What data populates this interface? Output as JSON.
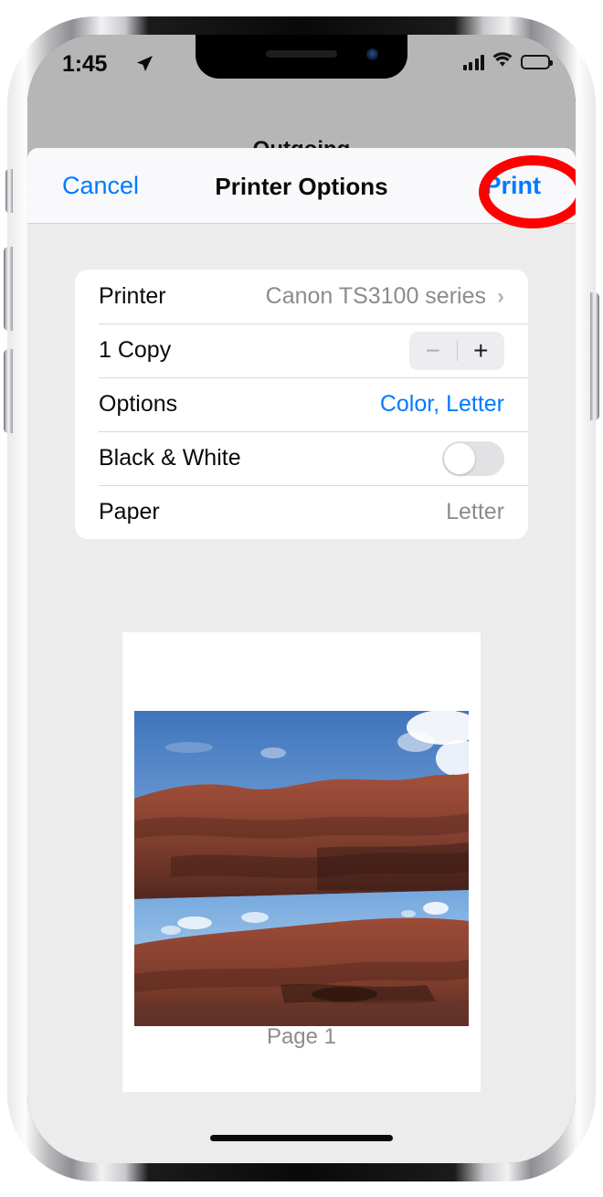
{
  "device": {
    "frame": "iphone-silver",
    "notch": true
  },
  "status_bar": {
    "time": "1:45",
    "location_icon": "location-arrow-icon",
    "cellular_icon": "cellular-bars-icon",
    "wifi_icon": "wifi-icon",
    "battery_icon": "battery-full-icon"
  },
  "background": {
    "obscured_title": "Outgoing"
  },
  "navbar": {
    "cancel_label": "Cancel",
    "title": "Printer Options",
    "print_label": "Print",
    "highlight_color": "#fd0000",
    "accent_color": "#007aff"
  },
  "settings": {
    "rows": [
      {
        "label": "Printer",
        "value": "Canon TS3100 series",
        "type": "disclosure",
        "chevron": "›",
        "value_color": "#8b8b90"
      },
      {
        "label": "1 Copy",
        "value": "",
        "type": "stepper",
        "minus_label": "−",
        "plus_label": "+",
        "minus_enabled": false,
        "plus_enabled": true
      },
      {
        "label": "Options",
        "value": "Color, Letter",
        "type": "link",
        "value_color": "#007aff"
      },
      {
        "label": "Black & White",
        "value": "",
        "type": "toggle",
        "toggle_on": false
      },
      {
        "label": "Paper",
        "value": "Letter",
        "type": "static",
        "value_color": "#8b8b90"
      }
    ]
  },
  "preview": {
    "page_label": "Page 1",
    "photo_alt": "rock-arch-photo",
    "sky_color": "#4a7ec0",
    "rock_color": "#8a4331"
  }
}
